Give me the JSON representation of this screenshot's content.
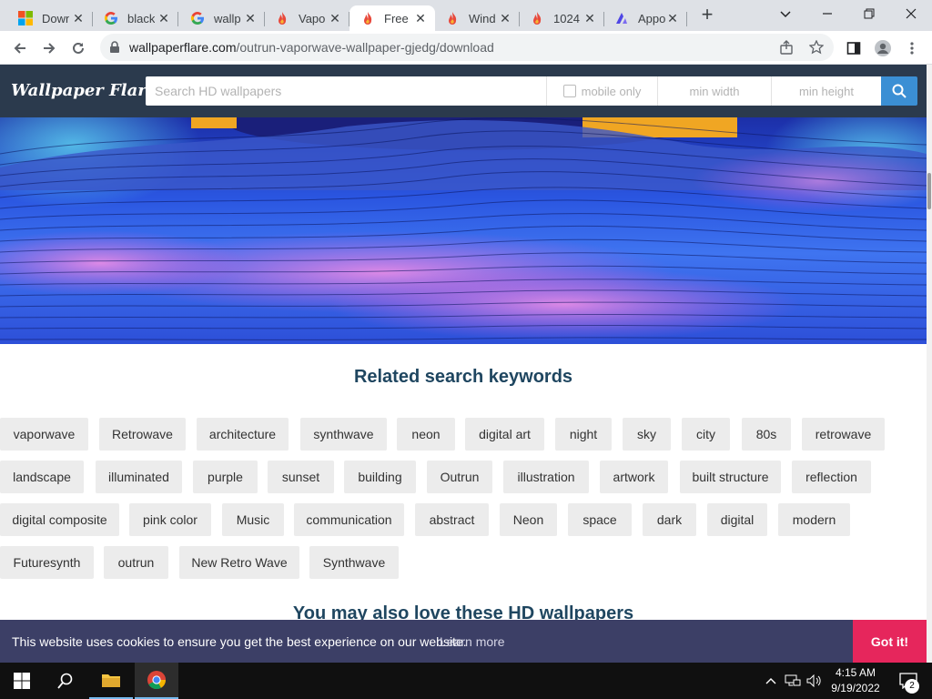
{
  "tabs": [
    {
      "title": "Down",
      "icon": "microsoft-icon"
    },
    {
      "title": "black",
      "icon": "google-icon"
    },
    {
      "title": "wallp",
      "icon": "google-icon"
    },
    {
      "title": "Vapo",
      "icon": "wallpaperflare-icon"
    },
    {
      "title": "Free",
      "icon": "wallpaperflare-icon",
      "active": true
    },
    {
      "title": "Wind",
      "icon": "wallpaperflare-icon"
    },
    {
      "title": "1024",
      "icon": "wallpaperflare-icon"
    },
    {
      "title": "Appo",
      "icon": "appo-icon"
    }
  ],
  "address": {
    "domain": "wallpaperflare.com",
    "path": "/outrun-vaporwave-wallpaper-gjedg/download"
  },
  "site": {
    "logo": "Wallpaper Flare",
    "search_placeholder": "Search HD wallpapers",
    "mobile_only": "mobile only",
    "min_width": "min width",
    "min_height": "min height"
  },
  "related": {
    "title": "Related search keywords",
    "rows": [
      [
        "vaporwave",
        "Retrowave",
        "architecture",
        "synthwave",
        "neon",
        "digital art",
        "night",
        "sky",
        "city",
        "80s",
        "retrowave"
      ],
      [
        "landscape",
        "illuminated",
        "purple",
        "sunset",
        "building",
        "Outrun",
        "illustration",
        "artwork",
        "built structure",
        "reflection"
      ],
      [
        "digital composite",
        "pink color",
        "Music",
        "communication",
        "abstract",
        "Neon",
        "space",
        "dark",
        "digital",
        "modern"
      ],
      [
        "Futuresynth",
        "outrun",
        "New Retro Wave",
        "Synthwave"
      ]
    ]
  },
  "love_title": "You may also love these HD wallpapers",
  "cookie": {
    "text": "This website uses cookies to ensure you get the best experience on our website.",
    "link": "Learn more",
    "button": "Got it!"
  },
  "taskbar": {
    "time": "4:15 AM",
    "date": "9/19/2022",
    "notifications": "2"
  },
  "colors": {
    "header": "#2b3a4d",
    "accent": "#3b8fd4",
    "cookie_bg": "#3c3f66",
    "gotit": "#e6265c",
    "title": "#1f4660"
  }
}
